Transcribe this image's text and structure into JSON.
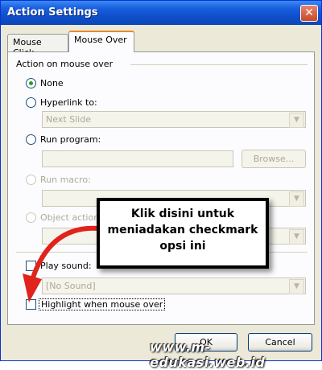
{
  "window": {
    "title": "Action Settings",
    "close_glyph": "✕"
  },
  "tabs": [
    {
      "label": "Mouse Click",
      "active": false
    },
    {
      "label": "Mouse Over",
      "active": true
    }
  ],
  "group": {
    "label": "Action on mouse over"
  },
  "options": {
    "none": {
      "label": "None",
      "selected": true
    },
    "hyperlink": {
      "label": "Hyperlink to:",
      "selected": false,
      "value": "Next Slide"
    },
    "run_program": {
      "label": "Run program:",
      "selected": false,
      "value": "",
      "browse_label": "Browse..."
    },
    "run_macro": {
      "label": "Run macro:",
      "selected": false,
      "value": ""
    },
    "object_action": {
      "label": "Object action:",
      "selected": false,
      "value": ""
    }
  },
  "play_sound": {
    "label": "Play sound:",
    "checked": false,
    "value": "[No Sound]"
  },
  "highlight": {
    "label": "Highlight when mouse over",
    "checked": false
  },
  "buttons": {
    "ok": "OK",
    "cancel": "Cancel"
  },
  "callout": {
    "line1": "Klik disini untuk",
    "line2": "meniadakan checkmark",
    "line3": "opsi ini"
  },
  "watermark": "www.m-edukasi.web.id",
  "colors": {
    "arrow": "#e0231c",
    "titlebar": "#0e4ec6",
    "radio_dot": "#21a121"
  }
}
